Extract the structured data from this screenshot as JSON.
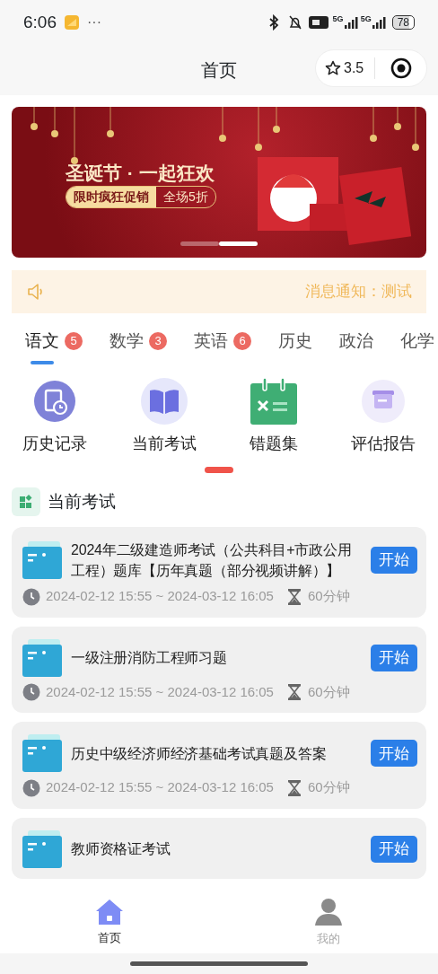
{
  "status_bar": {
    "time": "6:06",
    "more": "···",
    "network_1": "5G",
    "network_2": "5G",
    "battery": "78"
  },
  "header": {
    "title": "首页",
    "rating": "3.5"
  },
  "banner": {
    "headline": "圣诞节 · 一起狂欢",
    "promo_left": "限时疯狂促销",
    "promo_right": "全场5折",
    "slides": [
      {
        "selected": false
      },
      {
        "selected": true
      }
    ]
  },
  "notice": {
    "text": "消息通知：测试"
  },
  "subject_tabs": [
    {
      "label": "语文",
      "badge": "5",
      "selected": true
    },
    {
      "label": "数学",
      "badge": "3",
      "selected": false
    },
    {
      "label": "英语",
      "badge": "6",
      "selected": false
    },
    {
      "label": "历史",
      "selected": false
    },
    {
      "label": "政治",
      "selected": false
    },
    {
      "label": "化学",
      "selected": false
    }
  ],
  "features": [
    {
      "kind": "history",
      "label": "历史记录"
    },
    {
      "kind": "exam",
      "label": "当前考试"
    },
    {
      "kind": "mistakes",
      "label": "错题集"
    },
    {
      "kind": "report",
      "label": "评估报告"
    }
  ],
  "feature_pages": [
    {
      "selected": true
    }
  ],
  "section": {
    "title": "当前考试"
  },
  "exams": [
    {
      "title": "2024年二级建造师考试（公共科目+市政公用工程）题库【历年真题（部分视频讲解）】",
      "button": "开始",
      "time": "2024-02-12 15:55 ~ 2024-03-12 16:05",
      "duration": "60分钟"
    },
    {
      "title": "一级注册消防工程师习题",
      "button": "开始",
      "time": "2024-02-12 15:55 ~ 2024-03-12 16:05",
      "duration": "60分钟"
    },
    {
      "title": "历史中级经济师经济基础考试真题及答案",
      "button": "开始",
      "time": "2024-02-12 15:55 ~ 2024-03-12 16:05",
      "duration": "60分钟"
    },
    {
      "title": "教师资格证考试",
      "button": "开始"
    }
  ],
  "tab_bar": [
    {
      "kind": "home",
      "label": "首页",
      "selected": true
    },
    {
      "kind": "profile",
      "label": "我的",
      "selected": false
    }
  ]
}
